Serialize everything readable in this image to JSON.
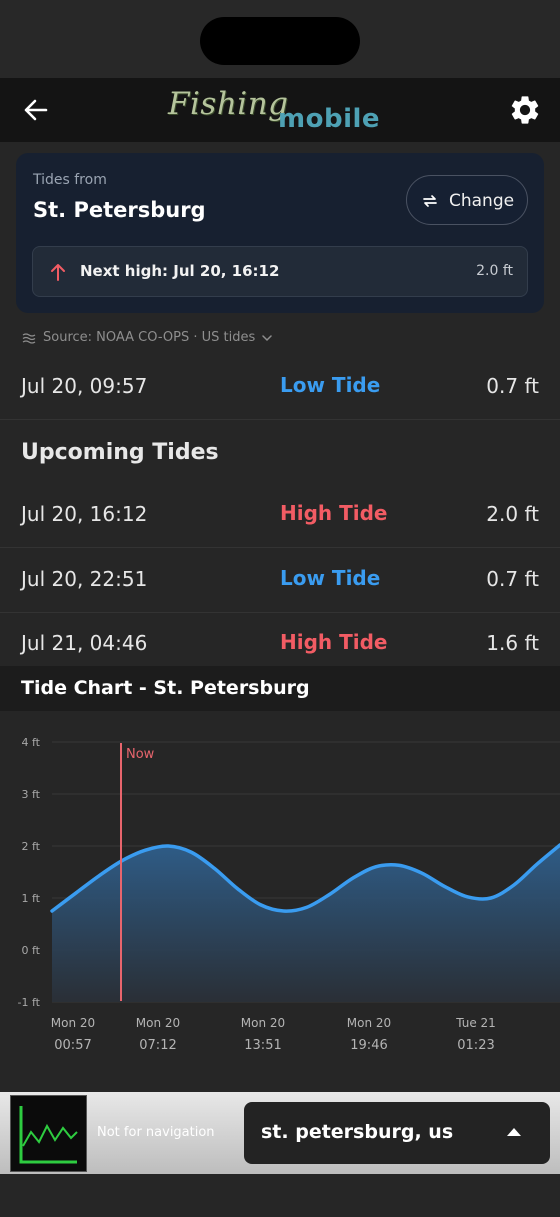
{
  "header": {
    "logo_fishing": "Fishing",
    "logo_mobile": "mobile"
  },
  "card": {
    "label": "Tides from",
    "location": "St. Petersburg",
    "change_label": "Change",
    "next_high_text": "Next high: Jul 20, 16:12",
    "next_high_value": "2.0 ft"
  },
  "source": {
    "text": "Source: NOAA CO-OPS · US tides"
  },
  "current_tide": {
    "time": "Jul 20, 09:57",
    "type": "Low Tide",
    "height": "0.7 ft"
  },
  "upcoming": {
    "title": "Upcoming Tides",
    "rows": [
      {
        "time": "Jul 20, 16:12",
        "type": "High Tide",
        "height": "2.0 ft"
      },
      {
        "time": "Jul 20, 22:51",
        "type": "Low Tide",
        "height": "0.7 ft"
      },
      {
        "time": "Jul 21, 04:46",
        "type": "High Tide",
        "height": "1.6 ft"
      }
    ]
  },
  "chart_header": {
    "title": "Tide Chart - St. Petersburg"
  },
  "chart_data": {
    "type": "area",
    "y_ticks": [
      "4 ft",
      "3 ft",
      "2 ft",
      "1 ft",
      "0 ft",
      "-1 ft"
    ],
    "ylim": [
      -1,
      4
    ],
    "x_ticks": [
      {
        "day": "Mon 20",
        "time": "00:57"
      },
      {
        "day": "Mon 20",
        "time": "07:12"
      },
      {
        "day": "Mon 20",
        "time": "13:51"
      },
      {
        "day": "Mon 20",
        "time": "19:46"
      },
      {
        "day": "Tue 21",
        "time": "01:23"
      }
    ],
    "now_label": "Now",
    "series": [
      {
        "points": [
          {
            "x": "00:57",
            "y": 0.75
          },
          {
            "x": "02:00",
            "y": 1.1
          },
          {
            "x": "03:00",
            "y": 1.43
          },
          {
            "x": "04:00",
            "y": 1.72
          },
          {
            "x": "05:00",
            "y": 1.92
          },
          {
            "x": "06:00",
            "y": 2.0
          },
          {
            "x": "07:00",
            "y": 1.88
          },
          {
            "x": "08:00",
            "y": 1.57
          },
          {
            "x": "09:00",
            "y": 1.18
          },
          {
            "x": "10:00",
            "y": 0.87
          },
          {
            "x": "11:00",
            "y": 0.75
          },
          {
            "x": "12:00",
            "y": 0.82
          },
          {
            "x": "13:00",
            "y": 1.07
          },
          {
            "x": "14:00",
            "y": 1.38
          },
          {
            "x": "15:00",
            "y": 1.6
          },
          {
            "x": "16:00",
            "y": 1.63
          },
          {
            "x": "17:00",
            "y": 1.48
          },
          {
            "x": "18:00",
            "y": 1.22
          },
          {
            "x": "19:00",
            "y": 1.02
          },
          {
            "x": "20:00",
            "y": 1.0
          },
          {
            "x": "21:00",
            "y": 1.25
          },
          {
            "x": "22:00",
            "y": 1.65
          },
          {
            "x": "23:00",
            "y": 2.02
          }
        ]
      }
    ],
    "colors": {
      "line": "#3a9cf0",
      "now_line": "#e8656d",
      "fill_top": "#2f5f8c",
      "fill_bottom": "#2a3038"
    }
  },
  "bottom_bar": {
    "nav_note": "Not for navigation",
    "location_value": "st. petersburg, us"
  },
  "icons": {
    "back": "arrow-left-icon",
    "settings": "gear-icon",
    "change": "swap-icon",
    "next_high": "arrow-up-icon",
    "source": "waves-icon",
    "source_dropdown": "chevron-down-icon",
    "select": "caret-up-icon",
    "app": "chart-app-icon"
  }
}
